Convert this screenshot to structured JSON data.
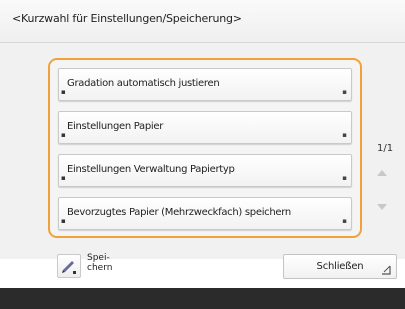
{
  "title": "<Kurzwahl für Einstellungen/Speicherung>",
  "items": [
    {
      "label": "Gradation automatisch justieren"
    },
    {
      "label": "Einstellungen Papier"
    },
    {
      "label": "Einstellungen Verwaltung Papiertyp"
    },
    {
      "label": "Bevorzugtes Papier (Mehrzweckfach) speichern"
    }
  ],
  "page_indicator": "1/1",
  "store_button": {
    "label": "Spei-\nchern",
    "icon": "pen-icon"
  },
  "close_button": {
    "label": "Schließen",
    "icon": "corner-arrow-icon"
  },
  "colors": {
    "accent": "#f0a23a",
    "bottom_bar": "#2b2b2b"
  }
}
